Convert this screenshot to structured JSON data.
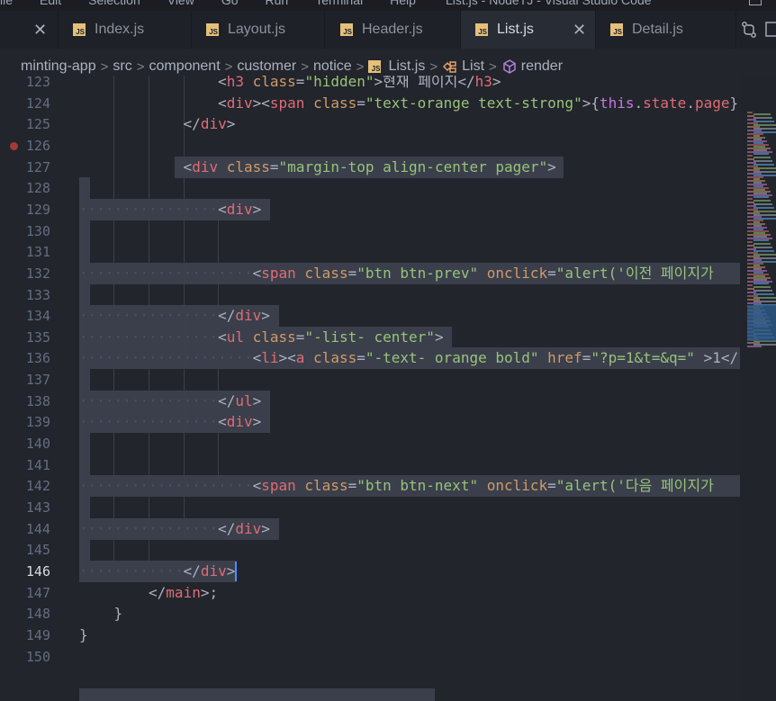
{
  "titlebar": {
    "menu": [
      "ile",
      "Edit",
      "Selection",
      "View",
      "Go",
      "Run",
      "Terminal",
      "Help"
    ],
    "window_title": "List.js - NodeTJ - Visual Studio Code"
  },
  "tabs": [
    {
      "label": "",
      "icon": "close-icon"
    },
    {
      "label": "Index.js",
      "icon": "js-file-icon"
    },
    {
      "label": "Layout.js",
      "icon": "js-file-icon"
    },
    {
      "label": "Header.js",
      "icon": "js-file-icon"
    },
    {
      "label": "List.js",
      "icon": "js-file-icon",
      "active": true
    },
    {
      "label": "Detail.js",
      "icon": "js-file-icon"
    }
  ],
  "tab_close_glyph": "✕",
  "js_badge": "JS",
  "breadcrumb": {
    "items": [
      "minting-app",
      "src",
      "component",
      "customer",
      "notice",
      "List.js",
      "List",
      "render"
    ],
    "separator": ">"
  },
  "editor": {
    "current_line": "146",
    "breakpoint_line": "126",
    "lines": [
      {
        "n": "123",
        "html": "<span class='punc'>&lt;</span><span class='tag'>h3</span> <span class='attr'>class</span><span class='punc'>=</span><span class='str'>\"hidden\"</span><span class='punc'>&gt;</span>현재 페이지<span class='punc'>&lt;/</span><span class='tag'>h3</span><span class='punc'>&gt;</span>"
      },
      {
        "n": "124",
        "html": "<span class='punc'>&lt;</span><span class='tag'>div</span><span class='punc'>&gt;&lt;</span><span class='tag'>span</span> <span class='attr'>class</span><span class='punc'>=</span><span class='str'>\"text-orange text-strong\"</span><span class='punc'>&gt;{</span><span class='kw'>this</span><span class='punc'>.</span><span class='prop'>state</span><span class='punc'>.</span><span class='prop'>page</span><span class='punc'>}</span>"
      },
      {
        "n": "125",
        "html": "<span class='punc'>&lt;/</span><span class='tag'>div</span><span class='punc'>&gt;</span>"
      },
      {
        "n": "126",
        "html": ""
      },
      {
        "n": "127",
        "html": "<span class='punc'>&lt;</span><span class='tag'>div</span> <span class='attr'>class</span><span class='punc'>=</span><span class='str'>\"margin-top align-center pager\"</span><span class='punc'>&gt;</span>"
      },
      {
        "n": "128",
        "html": ""
      },
      {
        "n": "129",
        "html": "<span class='punc'>&lt;</span><span class='tag'>div</span><span class='punc'>&gt;</span>"
      },
      {
        "n": "130",
        "html": ""
      },
      {
        "n": "131",
        "html": ""
      },
      {
        "n": "132",
        "html": "<span class='punc'>&lt;</span><span class='tag'>span</span> <span class='attr'>class</span><span class='punc'>=</span><span class='str'>\"btn btn-prev\"</span> <span class='attr'>onclick</span><span class='punc'>=</span><span class='str'>\"alert('이전 페이지가</span>"
      },
      {
        "n": "133",
        "html": ""
      },
      {
        "n": "134",
        "html": "<span class='punc'>&lt;/</span><span class='tag'>div</span><span class='punc'>&gt;</span>"
      },
      {
        "n": "135",
        "html": "<span class='punc'>&lt;</span><span class='tag'>ul</span> <span class='attr'>class</span><span class='punc'>=</span><span class='str'>\"-list- center\"</span><span class='punc'>&gt;</span>"
      },
      {
        "n": "136",
        "html": "<span class='punc'>&lt;</span><span class='tag'>li</span><span class='punc'>&gt;&lt;</span><span class='tag'>a</span> <span class='attr'>class</span><span class='punc'>=</span><span class='str'>\"-text- orange bold\"</span> <span class='attr'>href</span><span class='punc'>=</span><span class='str'>\"?p=1&amp;t=&amp;q=\"</span> <span class='punc'>&gt;</span>1<span class='punc'>&lt;/</span>"
      },
      {
        "n": "137",
        "html": ""
      },
      {
        "n": "138",
        "html": "<span class='punc'>&lt;/</span><span class='tag'>ul</span><span class='punc'>&gt;</span>"
      },
      {
        "n": "139",
        "html": "<span class='punc'>&lt;</span><span class='tag'>div</span><span class='punc'>&gt;</span>"
      },
      {
        "n": "140",
        "html": ""
      },
      {
        "n": "141",
        "html": ""
      },
      {
        "n": "142",
        "html": "<span class='punc'>&lt;</span><span class='tag'>span</span> <span class='attr'>class</span><span class='punc'>=</span><span class='str'>\"btn btn-next\"</span> <span class='attr'>onclick</span><span class='punc'>=</span><span class='str'>\"alert('다음 페이지가</span>"
      },
      {
        "n": "143",
        "html": ""
      },
      {
        "n": "144",
        "html": "<span class='punc'>&lt;/</span><span class='tag'>div</span><span class='punc'>&gt;</span>"
      },
      {
        "n": "145",
        "html": ""
      },
      {
        "n": "146",
        "html": "<span class='punc'>&lt;/</span><span class='tag'>div</span><span class='punc'>&gt;</span>"
      },
      {
        "n": "147",
        "html": "<span class='punc'>&lt;/</span><span class='tag'>main</span><span class='punc'>&gt;;</span>"
      },
      {
        "n": "148",
        "html": "<span class='punc'>}</span>"
      },
      {
        "n": "149",
        "html": "<span class='punc'>}</span>"
      },
      {
        "n": "150",
        "html": ""
      }
    ]
  },
  "colors": {
    "editor_bg": "#22252c",
    "tag": "#e06c75",
    "attr": "#d19a66",
    "string": "#98c379",
    "keyword": "#c678dd",
    "selection": "#3a3f4b",
    "js_icon": "#e5c07b"
  }
}
